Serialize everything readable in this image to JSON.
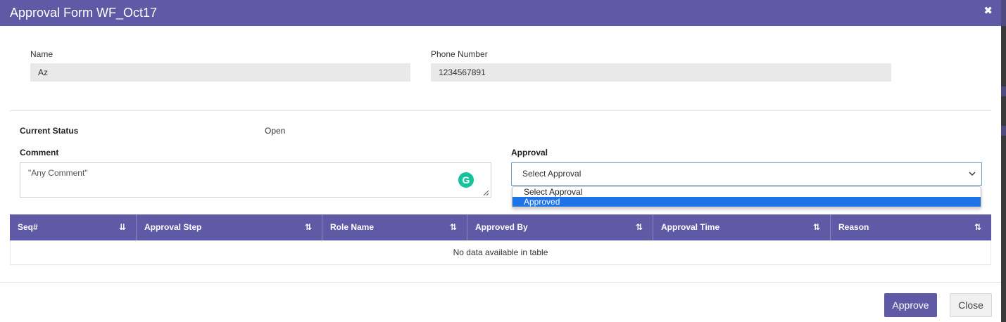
{
  "modal": {
    "title": "Approval Form WF_Oct17",
    "close_glyph": "✖"
  },
  "form": {
    "name_label": "Name",
    "name_value": "Az",
    "phone_label": "Phone Number",
    "phone_value": "1234567891",
    "status_label": "Current Status",
    "status_value": "Open",
    "comment_label": "Comment",
    "comment_value": "\"Any Comment\"",
    "approval_label": "Approval",
    "approval_selected": "Select Approval",
    "approval_options": [
      "Select Approval",
      "Approved"
    ]
  },
  "table": {
    "columns": [
      "Seq#",
      "Approval Step",
      "Role Name",
      "Approved By",
      "Approval Time",
      "Reason"
    ],
    "empty_message": "No data available in table"
  },
  "footer": {
    "approve_label": "Approve",
    "close_label": "Close"
  },
  "icons": {
    "grammarly": "G",
    "chevron_down": "⌄",
    "sort_active": "⇊",
    "sort": "⇅"
  },
  "colors": {
    "header_bg": "#5f5aa5",
    "selected_option": "#1e73e8",
    "grammarly": "#15c39a"
  }
}
